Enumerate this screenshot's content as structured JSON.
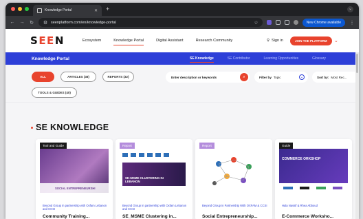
{
  "browser": {
    "tab_title": "Knowledge Portal",
    "url": "seenplatform.com/en/knowledge-portal",
    "update_button": "New Chrome available"
  },
  "site": {
    "logo_prefix": "S",
    "logo_ee": "EE",
    "logo_suffix": "N",
    "nav": [
      "Ecosystem",
      "Knowledge Portal",
      "Digital Assistant",
      "Research Community"
    ],
    "sign_in": "Sign in",
    "join": "JOIN THE PLATFORM"
  },
  "portal": {
    "title": "Knowledge Portal",
    "subnav": [
      "SE Knowledge",
      "SE Contributor",
      "Learning Opportunities",
      "Glossary"
    ]
  },
  "filters": {
    "pills": [
      "ALL",
      "ARTICLES (38)",
      "REPORTS (32)",
      "TOOLS & GUIDES (40)"
    ],
    "search_placeholder": "Enter description or keywords",
    "filter_topic_label": "Filter by",
    "filter_topic_value": "Topic",
    "sort_label": "Sort by:",
    "sort_value": "Most Rec..."
  },
  "section": {
    "title": "SE KNOWLEDGE"
  },
  "cards": [
    {
      "badge": "Tool and Guide",
      "badge_color": "#1a1a1a",
      "thumb_text": "SOCIAL ENTREPRENEURSHI",
      "meta": "Beyond Group in partnership with Oxfam Lebanon and CCSI",
      "title": "Community Training..."
    },
    {
      "badge": "Report",
      "badge_color": "#b48ddc",
      "thumb_text": "SE-MSME CLUSTERING IN LEBANON",
      "meta": "Beyond Group in partnership with Oxfam Lebanon and CCSI",
      "title": "SE_MSME Clustering in..."
    },
    {
      "badge": "Report",
      "badge_color": "#b48ddc",
      "thumb_text": "",
      "meta": "Beyond Group in Partnership With OXFAM & CCSI",
      "title": "Social Entrepreneurship..."
    },
    {
      "badge": "Guide",
      "badge_color": "#1a1a1a",
      "thumb_text": "COMMERCE ORKSHOP",
      "meta": "Hala Nassif & Rhea Abboud",
      "title": "E-Commerce Worksho..."
    }
  ]
}
